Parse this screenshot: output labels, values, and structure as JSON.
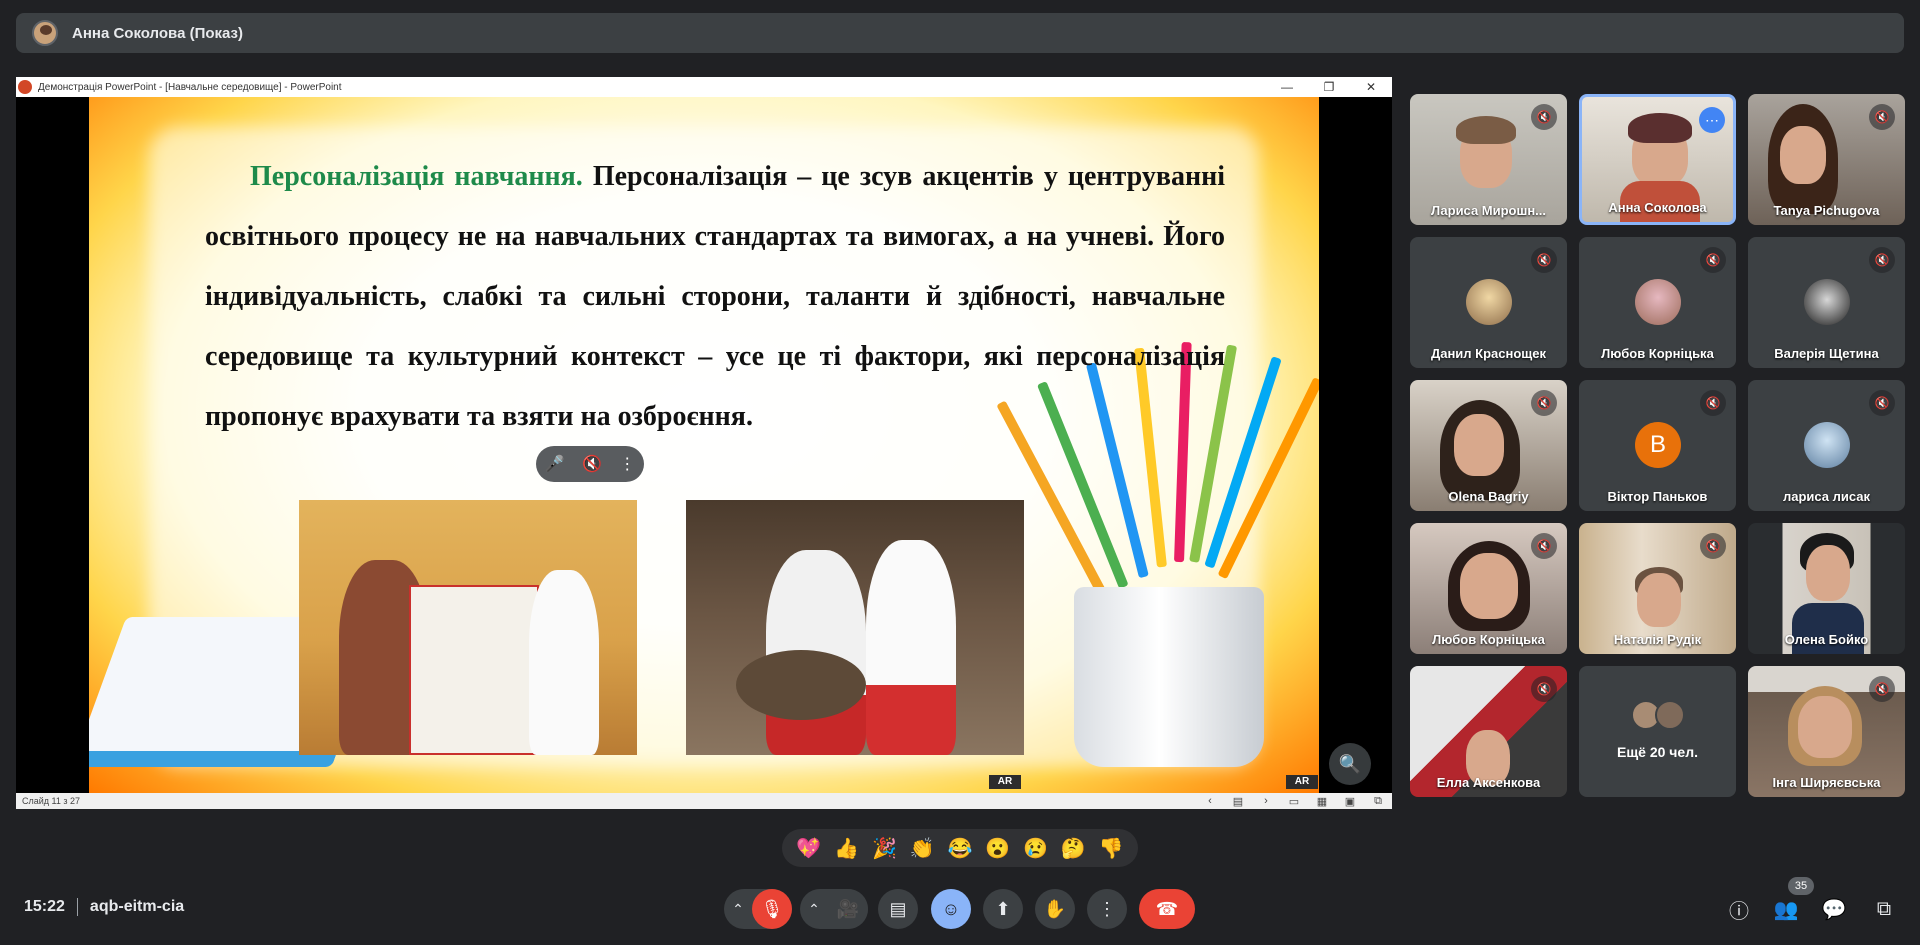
{
  "presenter": {
    "name": "Анна Соколова (Показ)"
  },
  "presentation": {
    "window_title": "Демонстрація PowerPoint - [Навчальне середовище] - PowerPoint",
    "slide_heading": "Персоналізація навчання.",
    "slide_body": "Персоналізація – це зсув акцентів у центруванні освітнього процесу не на навчальних стандартах та вимогах, а на учневі. Його індивідуальність, слабкі та сильні сторони, таланти й здібності, навчальне середовище та культурний контекст – усе це ті фактори, які персоналізація пропонує врахувати та взяти на озброєння.",
    "status_slide": "Слайд 11 з 27",
    "logo_text": "AR"
  },
  "participants": [
    {
      "name": "Лариса Мирошн...",
      "muted": true
    },
    {
      "name": "Анна Соколова",
      "muted": false,
      "active": true
    },
    {
      "name": "Tanya Pichugova",
      "muted": true
    },
    {
      "name": "Данил Краснощек",
      "muted": true
    },
    {
      "name": "Любов Корніцька",
      "muted": true
    },
    {
      "name": "Валерія Щетина",
      "muted": true
    },
    {
      "name": "Olena Bagriy",
      "muted": true
    },
    {
      "name": "Віктор Паньков",
      "muted": true,
      "letter": "В"
    },
    {
      "name": "лариса лисак",
      "muted": true
    },
    {
      "name": "Любов Корніцька",
      "muted": true
    },
    {
      "name": "Наталія Рудік",
      "muted": true
    },
    {
      "name": "Олена Бойко",
      "muted": true
    },
    {
      "name": "Елла Аксенкова",
      "muted": true
    },
    {
      "name": "Інга Ширяєвська",
      "muted": true
    }
  ],
  "more_participants": "Ещё 20 чел.",
  "reactions": [
    "💖",
    "👍",
    "🎉",
    "👏",
    "😂",
    "😮",
    "😢",
    "🤔",
    "👎"
  ],
  "meeting": {
    "time": "15:22",
    "code": "aqb-eitm-cia"
  },
  "people_count": "35",
  "colors": {
    "accent": "#8ab4f8",
    "danger": "#ea4335",
    "slide_heading": "#1e8a4a"
  }
}
